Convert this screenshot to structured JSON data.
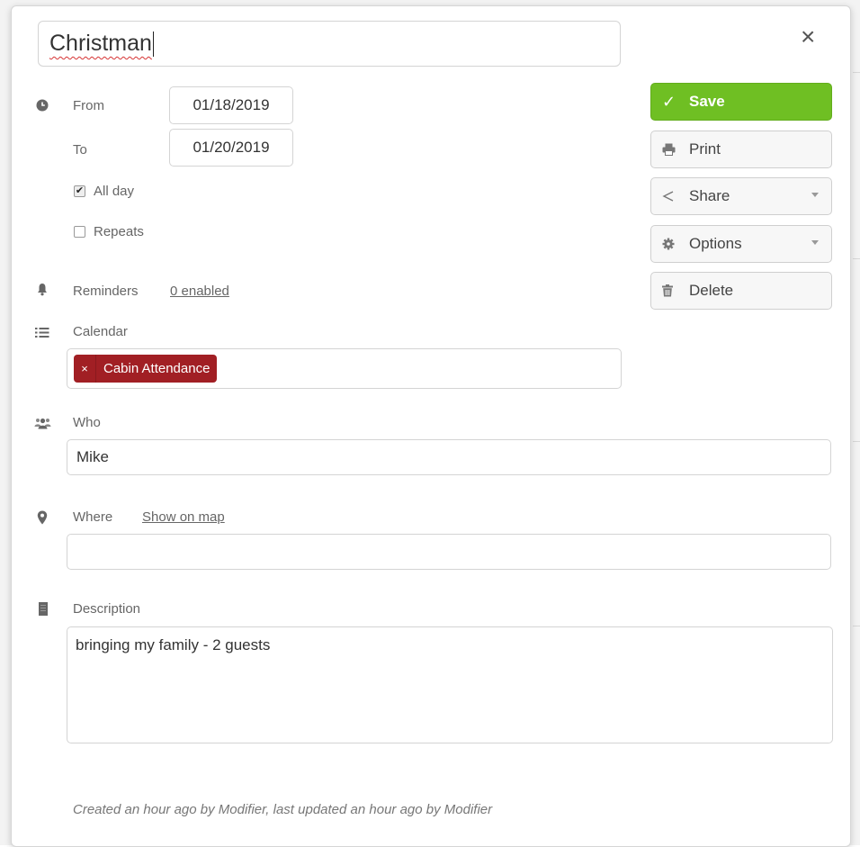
{
  "event": {
    "title": "Christman",
    "close_label": "×"
  },
  "when": {
    "from_label": "From",
    "from_value": "01/18/2019",
    "to_label": "To",
    "to_value": "01/20/2019",
    "all_day_label": "All day",
    "all_day_checked": true,
    "repeats_label": "Repeats",
    "repeats_checked": false
  },
  "reminders": {
    "label": "Reminders",
    "link": "0 enabled"
  },
  "calendar": {
    "label": "Calendar",
    "tag_remove": "×",
    "tag_label": "Cabin Attendance",
    "tag_color": "#a11f24"
  },
  "who": {
    "label": "Who",
    "value": "Mike"
  },
  "where": {
    "label": "Where",
    "link": "Show on map",
    "value": ""
  },
  "description": {
    "label": "Description",
    "value": "bringing my family - 2 guests"
  },
  "actions": {
    "save": "Save",
    "print": "Print",
    "share": "Share",
    "options": "Options",
    "delete": "Delete",
    "save_color": "#6fbf23"
  },
  "footer": {
    "meta": "Created an hour ago by Modifier, last updated an hour ago by Modifier"
  },
  "icons": {
    "clock": "clock-icon",
    "bell": "bell-icon",
    "list": "list-icon",
    "users": "users-icon",
    "marker": "map-marker-icon",
    "description": "description-icon",
    "check": "check-icon",
    "print": "print-icon",
    "share": "share-icon",
    "gear": "gear-icon",
    "trash": "trash-icon",
    "close": "close-icon"
  }
}
